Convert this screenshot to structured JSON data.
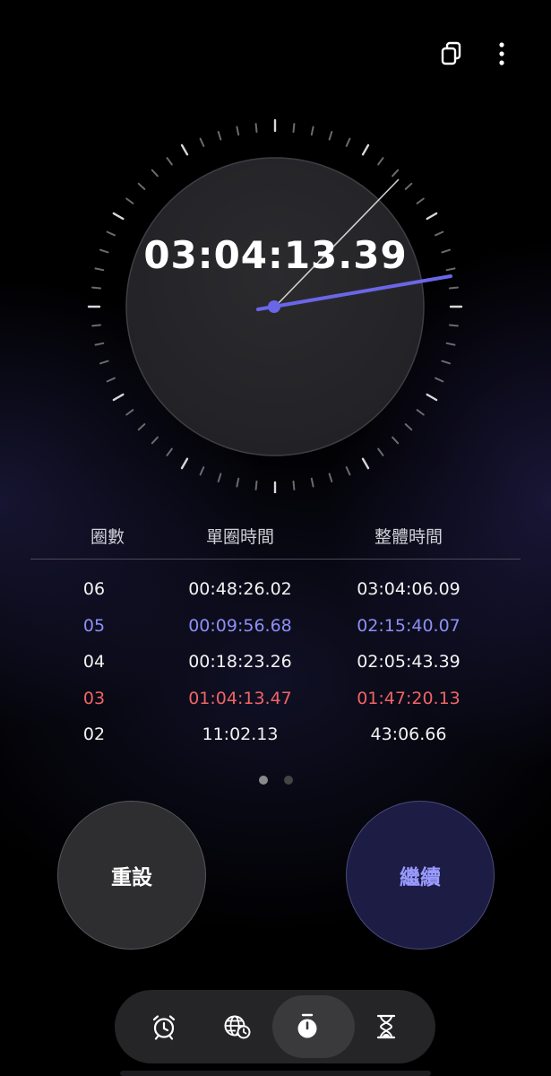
{
  "stopwatch": {
    "elapsed": "03:04:13.39"
  },
  "laps": {
    "headers": {
      "lap": "圈數",
      "split": "單圈時間",
      "total": "整體時間"
    },
    "rows": [
      {
        "lap": "06",
        "split": "00:48:26.02",
        "total": "03:04:06.09",
        "status": "normal"
      },
      {
        "lap": "05",
        "split": "00:09:56.68",
        "total": "02:15:40.07",
        "status": "fastest"
      },
      {
        "lap": "04",
        "split": "00:18:23.26",
        "total": "02:05:43.39",
        "status": "normal"
      },
      {
        "lap": "03",
        "split": "01:04:13.47",
        "total": "01:47:20.13",
        "status": "slowest"
      },
      {
        "lap": "02",
        "split": "11:02.13",
        "total": "43:06.66",
        "status": "normal"
      }
    ]
  },
  "controls": {
    "reset_label": "重設",
    "resume_label": "繼續"
  },
  "pager": {
    "pages": 2,
    "active": 0
  },
  "nav": {
    "items": [
      {
        "icon": "alarm-icon"
      },
      {
        "icon": "world-clock-icon"
      },
      {
        "icon": "stopwatch-icon",
        "active": true
      },
      {
        "icon": "timer-icon"
      }
    ]
  },
  "colors": {
    "fastest": "#8e8ff5",
    "slowest": "#f06464",
    "hand": "#6b66e8",
    "resume_text": "#9a9bff"
  },
  "top_actions": {
    "icons": [
      "multi-window-icon",
      "more-options-icon"
    ]
  }
}
